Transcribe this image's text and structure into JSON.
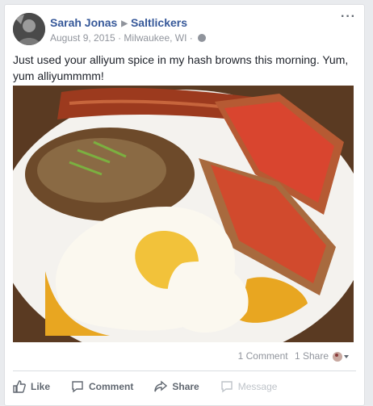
{
  "post": {
    "author": "Sarah Jonas",
    "page": "Saltlickers",
    "date": "August 9, 2015",
    "location": "Milwaukee, WI",
    "text": "Just used your alliyum spice in my hash browns this morning. Yum, yum alliyummmm!"
  },
  "stats": {
    "comments": "1 Comment",
    "shares": "1 Share"
  },
  "actions": {
    "like": "Like",
    "comment": "Comment",
    "share": "Share",
    "message": "Message"
  },
  "colors": {
    "link": "#365899",
    "meta": "#90949c"
  }
}
